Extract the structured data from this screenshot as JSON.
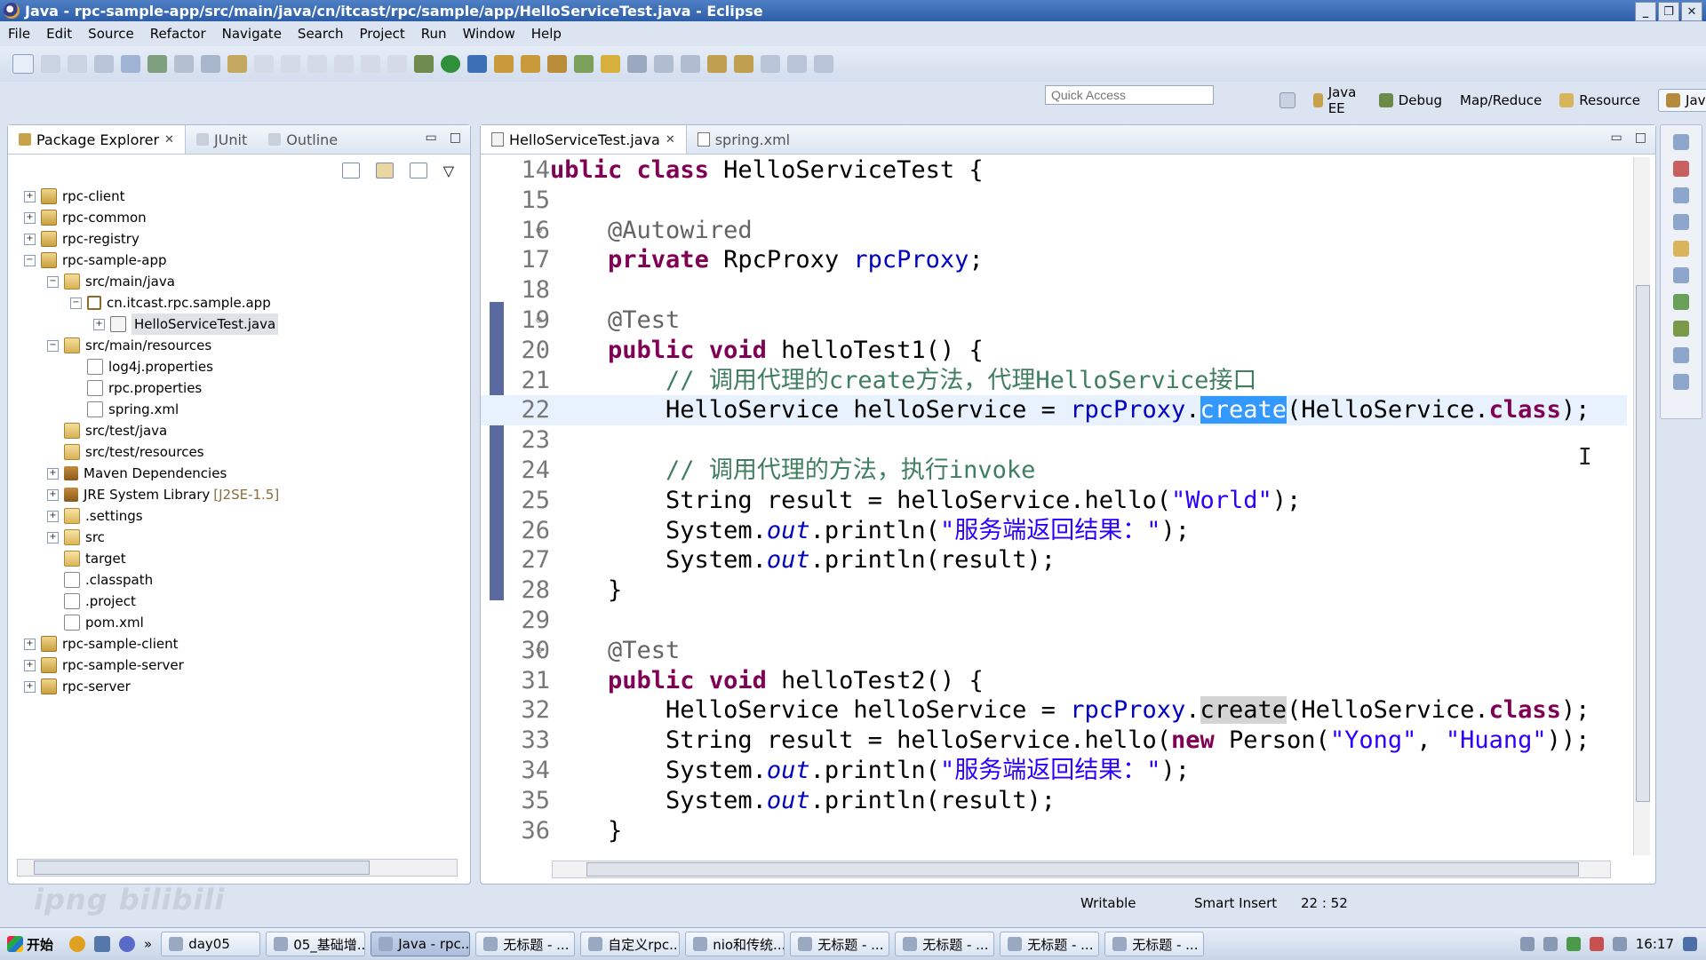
{
  "window": {
    "title": "Java - rpc-sample-app/src/main/java/cn/itcast/rpc/sample/app/HelloServiceTest.java - Eclipse",
    "btn_min": "_",
    "btn_max": "❐",
    "btn_close": "✕"
  },
  "menu": [
    "File",
    "Edit",
    "Source",
    "Refactor",
    "Navigate",
    "Search",
    "Project",
    "Run",
    "Window",
    "Help"
  ],
  "quick_access": {
    "placeholder": "Quick Access"
  },
  "perspectives": [
    "Java EE",
    "Debug",
    "Map/Reduce",
    "Resource",
    "Java"
  ],
  "left_tabs": {
    "package_explorer": "Package Explorer",
    "junit": "JUnit",
    "outline": "Outline",
    "close": "✕"
  },
  "tree": [
    {
      "label": "rpc-client",
      "icon": "project-icon",
      "expander": "+"
    },
    {
      "label": "rpc-common",
      "icon": "project-icon",
      "expander": "+"
    },
    {
      "label": "rpc-registry",
      "icon": "project-icon",
      "expander": "+"
    },
    {
      "label": "rpc-sample-app",
      "icon": "project-icon",
      "expander": "−"
    },
    {
      "label": "src/main/java",
      "icon": "source-folder-icon",
      "expander": "−"
    },
    {
      "label": "cn.itcast.rpc.sample.app",
      "icon": "package-icon",
      "expander": "−"
    },
    {
      "label": "HelloServiceTest.java",
      "icon": "java-file-icon",
      "expander": "+"
    },
    {
      "label": "src/main/resources",
      "icon": "source-folder-icon",
      "expander": "−"
    },
    {
      "label": "log4j.properties",
      "icon": "properties-file-icon",
      "expander": ""
    },
    {
      "label": "rpc.properties",
      "icon": "properties-file-icon",
      "expander": ""
    },
    {
      "label": "spring.xml",
      "icon": "xml-file-icon",
      "expander": ""
    },
    {
      "label": "src/test/java",
      "icon": "source-folder-icon",
      "expander": ""
    },
    {
      "label": "src/test/resources",
      "icon": "source-folder-icon",
      "expander": ""
    },
    {
      "label": "Maven Dependencies",
      "icon": "library-icon",
      "expander": "+"
    },
    {
      "label": "JRE System Library",
      "tag": "[J2SE-1.5]",
      "icon": "library-icon",
      "expander": "+"
    },
    {
      "label": ".settings",
      "icon": "folder-icon",
      "expander": "+"
    },
    {
      "label": "src",
      "icon": "folder-icon",
      "expander": "+"
    },
    {
      "label": "target",
      "icon": "folder-icon",
      "expander": ""
    },
    {
      "label": ".classpath",
      "icon": "xml-file-icon",
      "expander": ""
    },
    {
      "label": ".project",
      "icon": "xml-file-icon",
      "expander": ""
    },
    {
      "label": "pom.xml",
      "icon": "maven-file-icon",
      "expander": ""
    },
    {
      "label": "rpc-sample-client",
      "icon": "project-icon",
      "expander": "+"
    },
    {
      "label": "rpc-sample-server",
      "icon": "project-icon",
      "expander": "+"
    },
    {
      "label": "rpc-server",
      "icon": "project-icon",
      "expander": "+"
    }
  ],
  "editor_tabs": {
    "active": "HelloServiceTest.java",
    "other": "spring.xml",
    "close": "✕"
  },
  "code": [
    {
      "n": "14",
      "tokens": [
        [
          "kw",
          "ublic"
        ],
        [
          "",
          " "
        ],
        [
          "kw",
          "class"
        ],
        [
          "",
          " HelloServiceTest {"
        ]
      ]
    },
    {
      "n": "15",
      "tokens": []
    },
    {
      "n": "16",
      "fold": "⊖",
      "tokens": [
        [
          "",
          "    "
        ],
        [
          "ann",
          "@Autowired"
        ]
      ]
    },
    {
      "n": "17",
      "tokens": [
        [
          "",
          "    "
        ],
        [
          "kw",
          "private"
        ],
        [
          "",
          " RpcProxy "
        ],
        [
          "fld",
          "rpcProxy"
        ],
        [
          "",
          ";"
        ]
      ]
    },
    {
      "n": "18",
      "tokens": []
    },
    {
      "n": "19",
      "fold": "⊖",
      "tokens": [
        [
          "",
          "    "
        ],
        [
          "ann",
          "@Test"
        ]
      ]
    },
    {
      "n": "20",
      "tokens": [
        [
          "",
          "    "
        ],
        [
          "kw",
          "public"
        ],
        [
          "",
          " "
        ],
        [
          "kw",
          "void"
        ],
        [
          "",
          " helloTest1() {"
        ]
      ]
    },
    {
      "n": "21",
      "tokens": [
        [
          "",
          "        "
        ],
        [
          "cmt",
          "// 调用代理的create方法，代理HelloService接口"
        ]
      ]
    },
    {
      "n": "22",
      "current": true,
      "tokens": [
        [
          "",
          "        HelloService helloService = "
        ],
        [
          "fld",
          "rpcProxy"
        ],
        [
          "",
          "."
        ],
        [
          "sel",
          "create"
        ],
        [
          "",
          "(HelloService."
        ],
        [
          "kw",
          "class"
        ],
        [
          "",
          ");"
        ]
      ]
    },
    {
      "n": "23",
      "tokens": []
    },
    {
      "n": "24",
      "tokens": [
        [
          "",
          "        "
        ],
        [
          "cmt",
          "// 调用代理的方法，执行invoke"
        ]
      ]
    },
    {
      "n": "25",
      "tokens": [
        [
          "",
          "        String result = helloService.hello("
        ],
        [
          "str",
          "\"World\""
        ],
        [
          "",
          ");"
        ]
      ]
    },
    {
      "n": "26",
      "tokens": [
        [
          "",
          "        System."
        ],
        [
          "st",
          "out"
        ],
        [
          "",
          ".println("
        ],
        [
          "str",
          "\"服务端返回结果：\""
        ],
        [
          "",
          ");"
        ]
      ]
    },
    {
      "n": "27",
      "tokens": [
        [
          "",
          "        System."
        ],
        [
          "st",
          "out"
        ],
        [
          "",
          ".println(result);"
        ]
      ]
    },
    {
      "n": "28",
      "tokens": [
        [
          "",
          "    }"
        ]
      ]
    },
    {
      "n": "29",
      "tokens": []
    },
    {
      "n": "30",
      "fold": "⊖",
      "tokens": [
        [
          "",
          "    "
        ],
        [
          "ann",
          "@Test"
        ]
      ]
    },
    {
      "n": "31",
      "tokens": [
        [
          "",
          "    "
        ],
        [
          "kw",
          "public"
        ],
        [
          "",
          " "
        ],
        [
          "kw",
          "void"
        ],
        [
          "",
          " helloTest2() {"
        ]
      ]
    },
    {
      "n": "32",
      "tokens": [
        [
          "",
          "        HelloService helloService = "
        ],
        [
          "fld",
          "rpcProxy"
        ],
        [
          "",
          "."
        ],
        [
          "occ",
          "create"
        ],
        [
          "",
          "(HelloService."
        ],
        [
          "kw",
          "class"
        ],
        [
          "",
          ");"
        ]
      ]
    },
    {
      "n": "33",
      "tokens": [
        [
          "",
          "        String result = helloService.hello("
        ],
        [
          "kw",
          "new"
        ],
        [
          "",
          " Person("
        ],
        [
          "str",
          "\"Yong\""
        ],
        [
          "",
          ", "
        ],
        [
          "str",
          "\"Huang\""
        ],
        [
          "",
          "));"
        ]
      ]
    },
    {
      "n": "34",
      "tokens": [
        [
          "",
          "        System."
        ],
        [
          "st",
          "out"
        ],
        [
          "",
          ".println("
        ],
        [
          "str",
          "\"服务端返回结果：\""
        ],
        [
          "",
          ");"
        ]
      ]
    },
    {
      "n": "35",
      "tokens": [
        [
          "",
          "        System."
        ],
        [
          "st",
          "out"
        ],
        [
          "",
          ".println(result);"
        ]
      ]
    },
    {
      "n": "36",
      "tokens": [
        [
          "",
          "    }"
        ]
      ]
    }
  ],
  "status": {
    "writable": "Writable",
    "insert_mode": "Smart Insert",
    "position": "22 : 52"
  },
  "watermark": "ipng bilibili",
  "taskbar": {
    "start": "开始",
    "tasks": [
      "day05",
      "05_基础增...",
      "Java - rpc...",
      "无标题 - ...",
      "自定义rpc...",
      "nio和传统...",
      "无标题 - ...",
      "无标题 - ...",
      "无标题 - ...",
      "无标题 - ..."
    ],
    "active_index": 2,
    "clock": "16:17"
  }
}
